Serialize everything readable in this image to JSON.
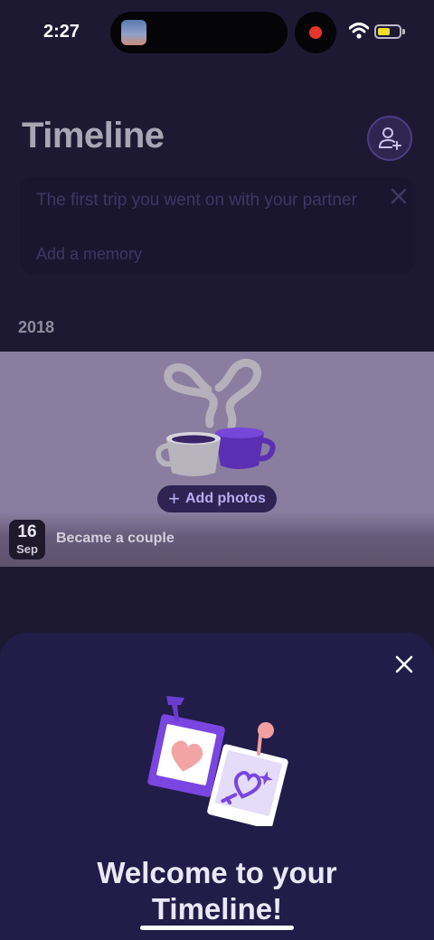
{
  "status_bar": {
    "time": "2:27",
    "recording": true,
    "battery_color": "#f2dc2a"
  },
  "header": {
    "title": "Timeline",
    "add_partner_icon": "add-person-icon"
  },
  "suggestion": {
    "text": "The first trip you went on with your partner",
    "action": "Add a memory"
  },
  "timeline": {
    "year": "2018",
    "memory": {
      "add_photos_label": "Add photos",
      "day": "16",
      "month": "Sep",
      "title": "Became a couple",
      "illustration": "coffee-cups-heart-steam"
    }
  },
  "sheet": {
    "title": "Welcome to your Timeline!",
    "illustration": "pinned-photos-heart-key"
  },
  "colors": {
    "accent": "#6a3fd0",
    "background": "#1e1933",
    "sheet": "#221c48"
  }
}
